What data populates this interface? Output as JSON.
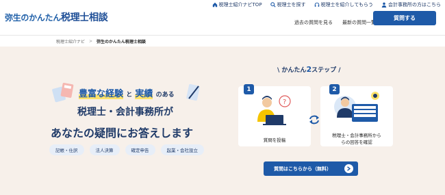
{
  "header": {
    "logo_prefix": "弥生のかんたん",
    "logo_main": "税理士相談",
    "top_links": [
      {
        "label": "税理士紹介ナビTOP",
        "icon": "home-icon"
      },
      {
        "label": "税理士を探す",
        "icon": "search-icon"
      },
      {
        "label": "税理士を紹介してもらう",
        "icon": "headset-icon"
      },
      {
        "label": "会計事務所の方はこちら",
        "icon": "user-icon"
      }
    ],
    "sub_links": [
      "過去の質問を見る",
      "最新の質問一覧"
    ],
    "ask_button": "質問する"
  },
  "breadcrumb": {
    "root": "税理士紹介ナビ",
    "separator": ">",
    "current": "弥生のかんたん税理士相談"
  },
  "hero": {
    "line1_hl1": "豊富な経験",
    "line1_and": "と",
    "line1_hl2": "実績",
    "line1_tail": "のある",
    "line2": "税理士・会計事務所が",
    "line3": "あなたの疑問にお答えします",
    "tags": [
      "記帳・仕訳",
      "法人決算",
      "確定申告",
      "起業・会社設立"
    ]
  },
  "steps": {
    "title_prefix": "かんたん",
    "title_num": "2",
    "title_suffix": "ステップ",
    "step1_num": "1",
    "step1_label": "質問を投稿",
    "step2_num": "2",
    "step2_line1": "税理士・会計事務所から",
    "step2_line2": "らの回答を確認",
    "cta": "質問はこちらから（無料）"
  },
  "colors": {
    "brand": "#1e5aa8",
    "hero_bg": "#f7f0ea",
    "highlight": "#ffe26b"
  }
}
